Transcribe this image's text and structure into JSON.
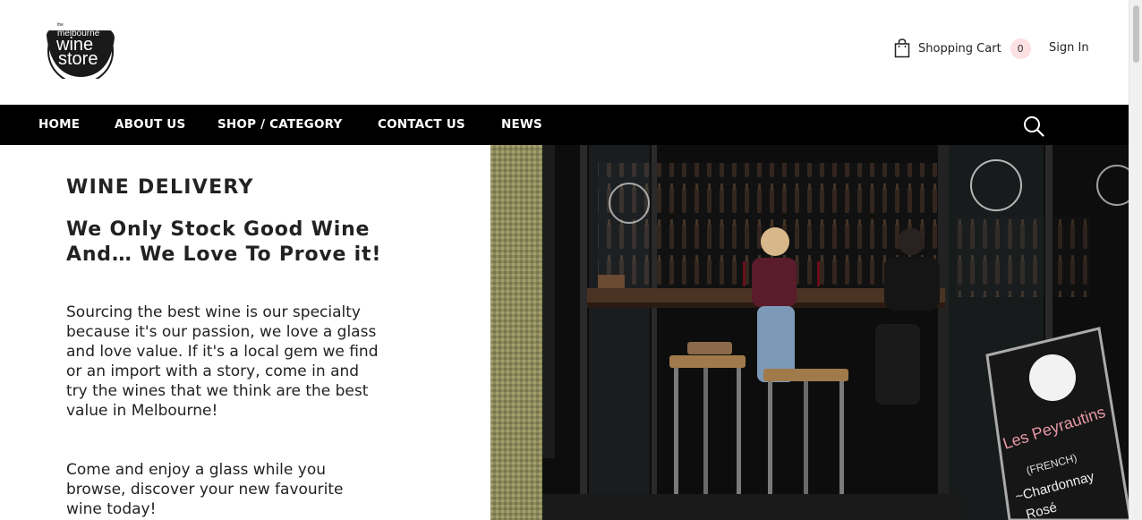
{
  "brand": {
    "logo_line_small": "the",
    "logo_line_top": "melbourne",
    "logo_line_mid": "wine",
    "logo_line_bottom": "store"
  },
  "header": {
    "cart_label": "Shopping Cart",
    "cart_count": "0",
    "signin_label": "Sign In"
  },
  "nav": {
    "items": [
      {
        "label": "HOME"
      },
      {
        "label": "ABOUT US"
      },
      {
        "label": "SHOP / CATEGORY"
      },
      {
        "label": "CONTACT US"
      },
      {
        "label": "NEWS"
      }
    ]
  },
  "hero": {
    "eyebrow": "WINE DELIVERY",
    "headline": "We Only Stock Good Wine And… We Love To Prove it!",
    "paragraph_1": "Sourcing the best wine is our specialty because it's our passion, we love a glass and love value. If it's a local gem we find or an import with a story, come in and try the wines that we think are the best value in Melbourne!",
    "paragraph_2": "Come and enjoy a glass while you browse, discover your new favourite wine today!"
  },
  "photo": {
    "sign_line_1": "Les Peyrautins",
    "sign_line_2": "(FRENCH)",
    "sign_line_3": "~Chardonnay",
    "sign_line_4": "Rosé"
  },
  "colors": {
    "nav_bg": "#000000",
    "cart_badge_bg": "#fde0e2",
    "text": "#222222"
  }
}
